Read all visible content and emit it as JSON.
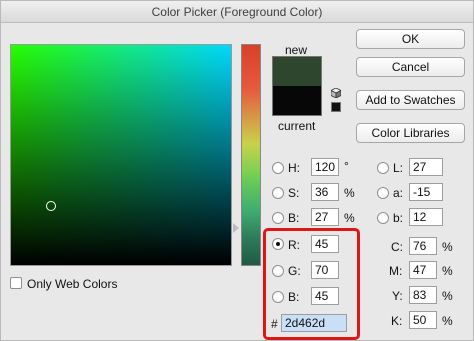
{
  "window": {
    "title": "Color Picker (Foreground Color)"
  },
  "swatches": {
    "new_label": "new",
    "current_label": "current",
    "new_color": "#2d462d",
    "current_color": "#070707"
  },
  "buttons": {
    "ok": "OK",
    "cancel": "Cancel",
    "add_to_swatches": "Add to Swatches",
    "color_libraries": "Color Libraries"
  },
  "hsb": {
    "h": {
      "label": "H:",
      "value": "120",
      "unit": "°"
    },
    "s": {
      "label": "S:",
      "value": "36",
      "unit": "%"
    },
    "b": {
      "label": "B:",
      "value": "27",
      "unit": "%"
    }
  },
  "lab": {
    "l": {
      "label": "L:",
      "value": "27"
    },
    "a": {
      "label": "a:",
      "value": "-15"
    },
    "b": {
      "label": "b:",
      "value": "12"
    }
  },
  "rgb": {
    "r": {
      "label": "R:",
      "value": "45",
      "selected": true
    },
    "g": {
      "label": "G:",
      "value": "70"
    },
    "b": {
      "label": "B:",
      "value": "45"
    }
  },
  "hex": {
    "label": "#",
    "value": "2d462d"
  },
  "cmyk": {
    "c": {
      "label": "C:",
      "value": "76",
      "unit": "%"
    },
    "m": {
      "label": "M:",
      "value": "47",
      "unit": "%"
    },
    "y": {
      "label": "Y:",
      "value": "83",
      "unit": "%"
    },
    "k": {
      "label": "K:",
      "value": "50",
      "unit": "%"
    }
  },
  "options": {
    "only_web_colors": "Only Web Colors",
    "only_web_colors_checked": false
  },
  "icons": {
    "gamut": "cube-icon",
    "websafe": "websafe-swatch-icon"
  }
}
